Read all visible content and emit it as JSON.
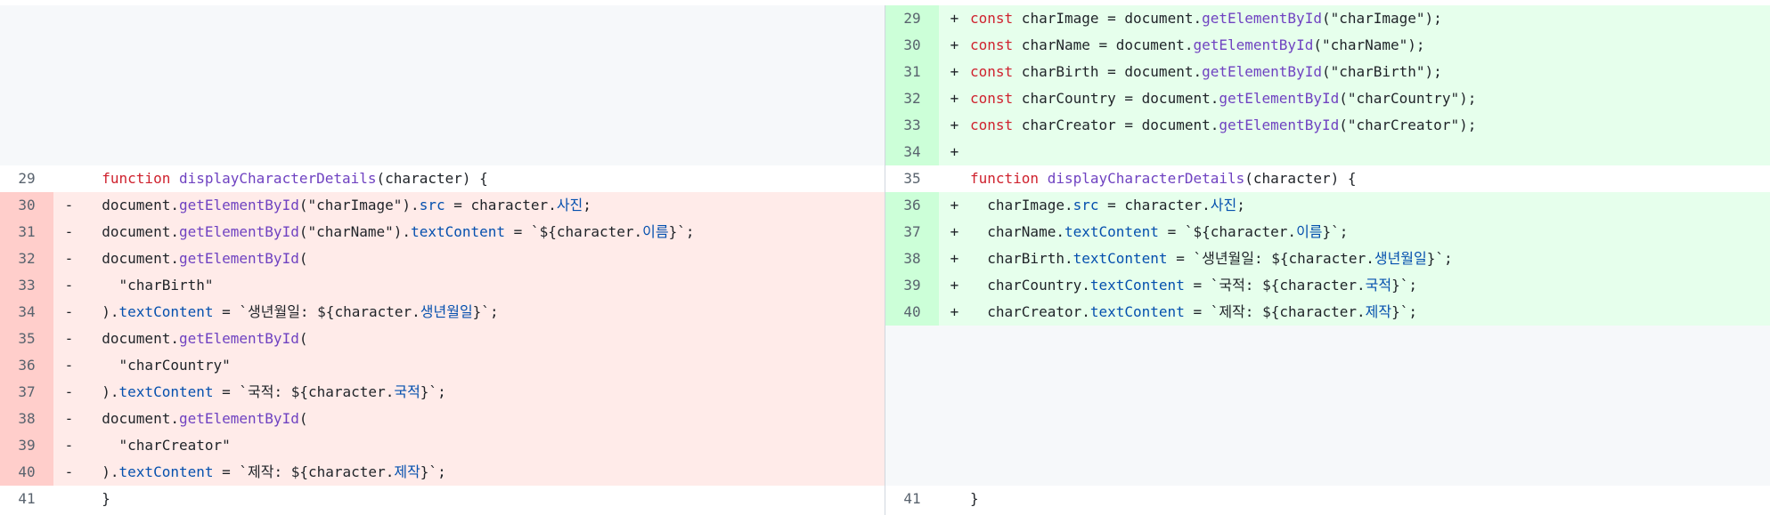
{
  "left": {
    "filler_rows": 6,
    "lines": [
      {
        "num": "29",
        "type": "ctx",
        "marker": "",
        "tokens": [
          [
            "  "
          ],
          [
            "function",
            "fn-kw"
          ],
          [
            " "
          ],
          [
            "displayCharacterDetails",
            "fn"
          ],
          [
            "(character) {"
          ]
        ]
      },
      {
        "num": "30",
        "type": "del",
        "marker": "-",
        "tokens": [
          [
            "  document."
          ],
          [
            "getElementById",
            "fn"
          ],
          [
            "(\"charImage\")."
          ],
          [
            "src",
            "prop"
          ],
          [
            " = character."
          ],
          [
            "사진",
            "kor"
          ],
          [
            ";"
          ]
        ]
      },
      {
        "num": "31",
        "type": "del",
        "marker": "-",
        "tokens": [
          [
            "  document."
          ],
          [
            "getElementById",
            "fn"
          ],
          [
            "(\"charName\")."
          ],
          [
            "textContent",
            "prop"
          ],
          [
            " = `${character."
          ],
          [
            "이름",
            "kor"
          ],
          [
            "}`;"
          ]
        ]
      },
      {
        "num": "32",
        "type": "del",
        "marker": "-",
        "tokens": [
          [
            "  document."
          ],
          [
            "getElementById",
            "fn"
          ],
          [
            "("
          ]
        ]
      },
      {
        "num": "33",
        "type": "del",
        "marker": "-",
        "tokens": [
          [
            "    \"charBirth\""
          ]
        ]
      },
      {
        "num": "34",
        "type": "del",
        "marker": "-",
        "tokens": [
          [
            "  )."
          ],
          [
            "textContent",
            "prop"
          ],
          [
            " = `생년월일: ${character."
          ],
          [
            "생년월일",
            "kor"
          ],
          [
            "}`;"
          ]
        ]
      },
      {
        "num": "35",
        "type": "del",
        "marker": "-",
        "tokens": [
          [
            "  document."
          ],
          [
            "getElementById",
            "fn"
          ],
          [
            "("
          ]
        ]
      },
      {
        "num": "36",
        "type": "del",
        "marker": "-",
        "tokens": [
          [
            "    \"charCountry\""
          ]
        ]
      },
      {
        "num": "37",
        "type": "del",
        "marker": "-",
        "tokens": [
          [
            "  )."
          ],
          [
            "textContent",
            "prop"
          ],
          [
            " = `국적: ${character."
          ],
          [
            "국적",
            "kor"
          ],
          [
            "}`;"
          ]
        ]
      },
      {
        "num": "38",
        "type": "del",
        "marker": "-",
        "tokens": [
          [
            "  document."
          ],
          [
            "getElementById",
            "fn"
          ],
          [
            "("
          ]
        ]
      },
      {
        "num": "39",
        "type": "del",
        "marker": "-",
        "tokens": [
          [
            "    \"charCreator\""
          ]
        ]
      },
      {
        "num": "40",
        "type": "del",
        "marker": "-",
        "tokens": [
          [
            "  )."
          ],
          [
            "textContent",
            "prop"
          ],
          [
            " = `제작: ${character."
          ],
          [
            "제작",
            "kor"
          ],
          [
            "}`;"
          ]
        ]
      },
      {
        "num": "41",
        "type": "ctx",
        "marker": "",
        "tokens": [
          [
            "  }"
          ]
        ]
      }
    ]
  },
  "right": {
    "lines": [
      {
        "num": "29",
        "type": "add",
        "marker": "+",
        "tokens": [
          [
            "const",
            "kw"
          ],
          [
            " charImage = document."
          ],
          [
            "getElementById",
            "fn"
          ],
          [
            "(\"charImage\");"
          ]
        ]
      },
      {
        "num": "30",
        "type": "add",
        "marker": "+",
        "tokens": [
          [
            "const",
            "kw"
          ],
          [
            " charName = document."
          ],
          [
            "getElementById",
            "fn"
          ],
          [
            "(\"charName\");"
          ]
        ]
      },
      {
        "num": "31",
        "type": "add",
        "marker": "+",
        "tokens": [
          [
            "const",
            "kw"
          ],
          [
            " charBirth = document."
          ],
          [
            "getElementById",
            "fn"
          ],
          [
            "(\"charBirth\");"
          ]
        ]
      },
      {
        "num": "32",
        "type": "add",
        "marker": "+",
        "tokens": [
          [
            "const",
            "kw"
          ],
          [
            " charCountry = document."
          ],
          [
            "getElementById",
            "fn"
          ],
          [
            "(\"charCountry\");"
          ]
        ]
      },
      {
        "num": "33",
        "type": "add",
        "marker": "+",
        "tokens": [
          [
            "const",
            "kw"
          ],
          [
            " charCreator = document."
          ],
          [
            "getElementById",
            "fn"
          ],
          [
            "(\"charCreator\");"
          ]
        ]
      },
      {
        "num": "34",
        "type": "add",
        "marker": "+",
        "tokens": [
          [
            ""
          ]
        ]
      },
      {
        "num": "35",
        "type": "ctx",
        "marker": "",
        "tokens": [
          [
            "function",
            "fn-kw"
          ],
          [
            " "
          ],
          [
            "displayCharacterDetails",
            "fn"
          ],
          [
            "(character) {"
          ]
        ]
      },
      {
        "num": "36",
        "type": "add",
        "marker": "+",
        "tokens": [
          [
            "  charImage."
          ],
          [
            "src",
            "prop"
          ],
          [
            " = character."
          ],
          [
            "사진",
            "kor"
          ],
          [
            ";"
          ]
        ]
      },
      {
        "num": "37",
        "type": "add",
        "marker": "+",
        "tokens": [
          [
            "  charName."
          ],
          [
            "textContent",
            "prop"
          ],
          [
            " = `${character."
          ],
          [
            "이름",
            "kor"
          ],
          [
            "}`;"
          ]
        ]
      },
      {
        "num": "38",
        "type": "add",
        "marker": "+",
        "tokens": [
          [
            "  charBirth."
          ],
          [
            "textContent",
            "prop"
          ],
          [
            " = `생년월일: ${character."
          ],
          [
            "생년월일",
            "kor"
          ],
          [
            "}`;"
          ]
        ]
      },
      {
        "num": "39",
        "type": "add",
        "marker": "+",
        "tokens": [
          [
            "  charCountry."
          ],
          [
            "textContent",
            "prop"
          ],
          [
            " = `국적: ${character."
          ],
          [
            "국적",
            "kor"
          ],
          [
            "}`;"
          ]
        ]
      },
      {
        "num": "40",
        "type": "add",
        "marker": "+",
        "tokens": [
          [
            "  charCreator."
          ],
          [
            "textContent",
            "prop"
          ],
          [
            " = `제작: ${character."
          ],
          [
            "제작",
            "kor"
          ],
          [
            "}`;"
          ]
        ]
      }
    ],
    "filler_rows": 6,
    "tail": [
      {
        "num": "41",
        "type": "ctx",
        "marker": "",
        "tokens": [
          [
            "}"
          ]
        ]
      }
    ]
  },
  "colors": {
    "deletion_bg": "#ffebe9",
    "deletion_gutter": "#ffcecb",
    "addition_bg": "#e6ffec",
    "addition_gutter": "#ccffd8",
    "empty_bg": "#f6f8fa"
  }
}
